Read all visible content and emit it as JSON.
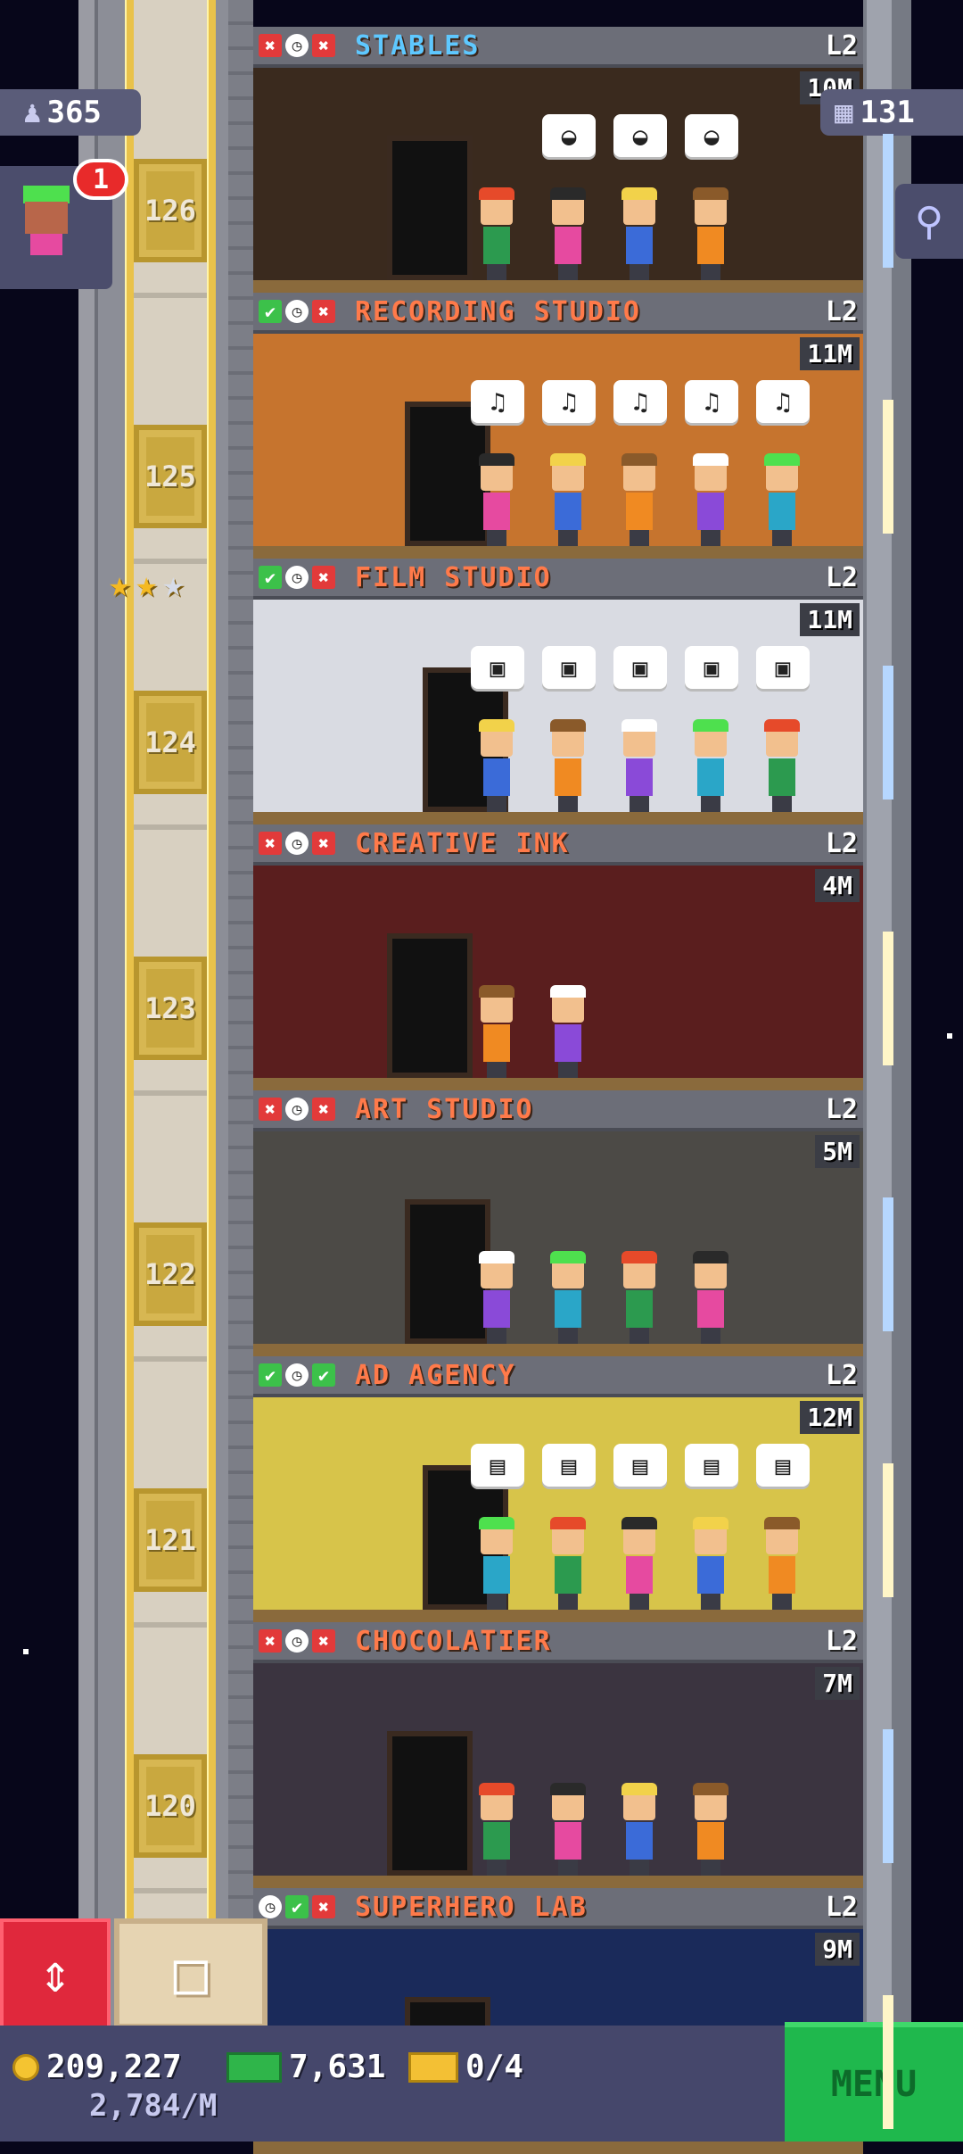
{
  "hud": {
    "population": "365",
    "floors_count": "131",
    "visitor_badge": "1"
  },
  "shaft_floor_numbers": [
    "126",
    "125",
    "124",
    "123",
    "122",
    "121",
    "120"
  ],
  "rating_stars_earned": 2,
  "rating_stars_total": 3,
  "floors": [
    {
      "name": "STABLES",
      "level": "L2",
      "price": "10M",
      "status": [
        "x",
        "clock",
        "x"
      ],
      "name_color": "#5ec8ff",
      "theme": "#3a2a1e"
    },
    {
      "name": "RECORDING STUDIO",
      "level": "L2",
      "price": "11M",
      "status": [
        "ok",
        "clock",
        "x"
      ],
      "name_color": "#ff7a4a",
      "theme": "#c6742e"
    },
    {
      "name": "FILM STUDIO",
      "level": "L2",
      "price": "11M",
      "status": [
        "ok",
        "clock",
        "x"
      ],
      "name_color": "#ff7a4a",
      "theme": "#d9dbe2"
    },
    {
      "name": "CREATIVE INK",
      "level": "L2",
      "price": "4M",
      "status": [
        "x",
        "clock",
        "x"
      ],
      "name_color": "#ff7a4a",
      "theme": "#5a1e1e"
    },
    {
      "name": "ART STUDIO",
      "level": "L2",
      "price": "5M",
      "status": [
        "x",
        "clock",
        "x"
      ],
      "name_color": "#ff7a4a",
      "theme": "#4c4a46"
    },
    {
      "name": "AD AGENCY",
      "level": "L2",
      "price": "12M",
      "status": [
        "ok",
        "clock",
        "ok"
      ],
      "name_color": "#ff7a4a",
      "theme": "#d7c44a"
    },
    {
      "name": "CHOCOLATIER",
      "level": "L2",
      "price": "7M",
      "status": [
        "x",
        "clock",
        "x"
      ],
      "name_color": "#ff7a4a",
      "theme": "#3b3440"
    },
    {
      "name": "SUPERHERO LAB",
      "level": "L2",
      "price": "9M",
      "status": [
        "clock",
        "ok",
        "x"
      ],
      "name_color": "#ff7a4a",
      "theme": "#1a2a5a"
    }
  ],
  "bottom": {
    "coins": "209,227",
    "bux": "7,631",
    "tickets": "0/4",
    "rate": "2,784/M",
    "menu_label": "MENU"
  },
  "icons": {
    "population": "person-icon",
    "floors": "building-icon",
    "search": "magnifier-icon",
    "elevator": "up-down-arrows-icon",
    "build": "box-icon"
  }
}
